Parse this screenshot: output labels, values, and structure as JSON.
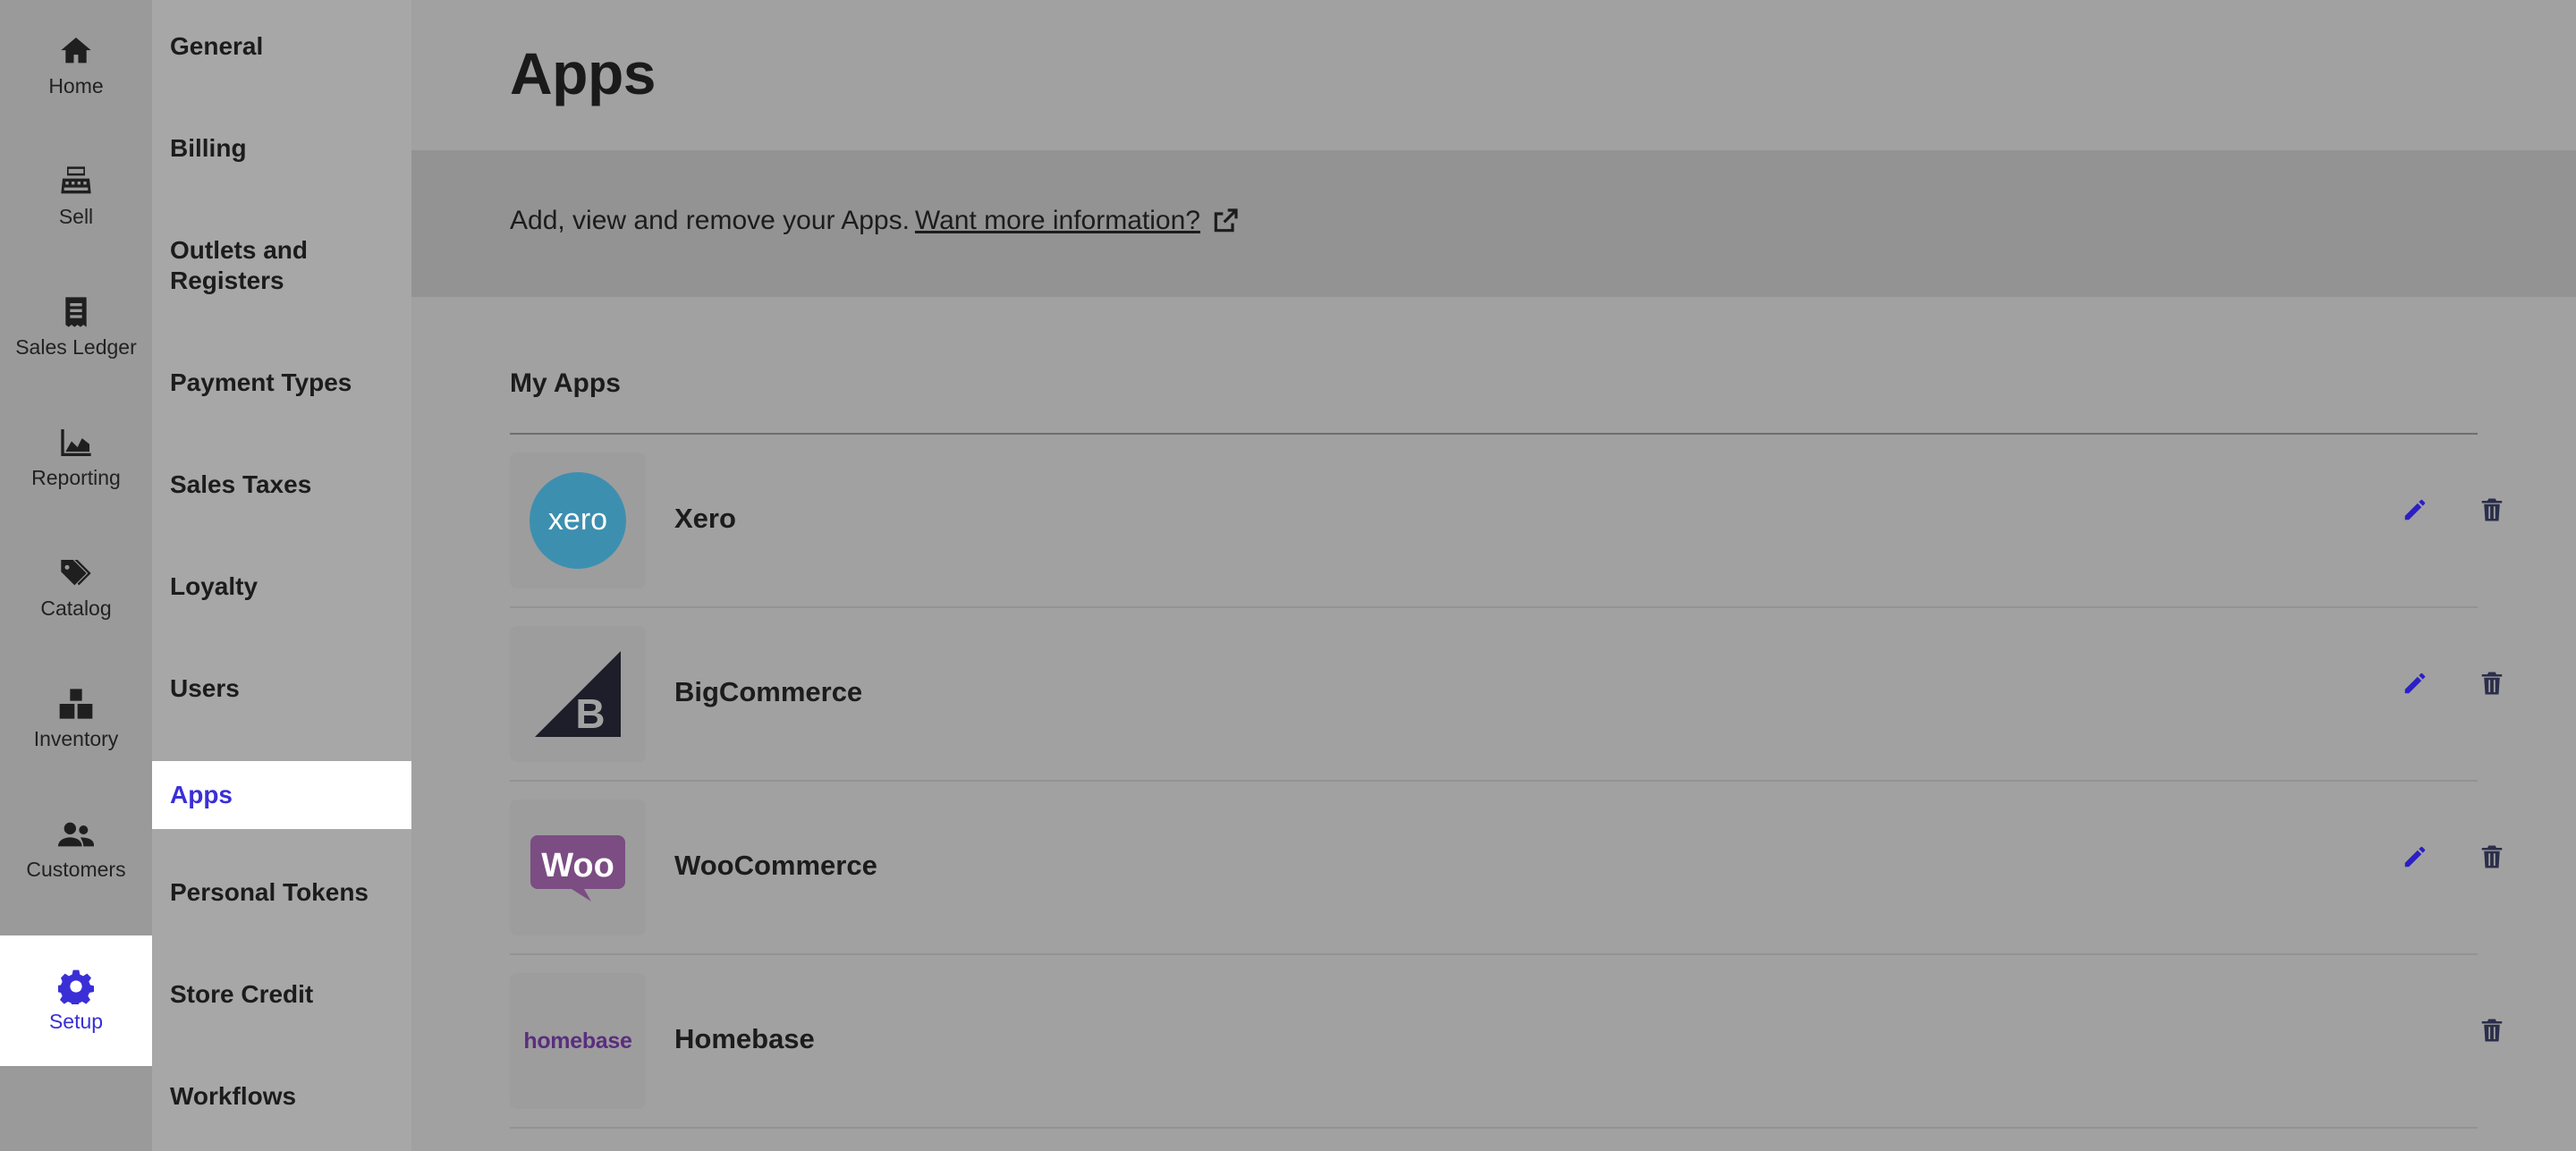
{
  "rail": {
    "items": [
      {
        "label": "Home",
        "icon": "home-icon"
      },
      {
        "label": "Sell",
        "icon": "register-icon"
      },
      {
        "label": "Sales Ledger",
        "icon": "receipt-icon"
      },
      {
        "label": "Reporting",
        "icon": "area-chart-icon"
      },
      {
        "label": "Catalog",
        "icon": "tags-icon"
      },
      {
        "label": "Inventory",
        "icon": "boxes-icon"
      },
      {
        "label": "Customers",
        "icon": "users-icon"
      },
      {
        "label": "Setup",
        "icon": "gear-icon",
        "active": true
      }
    ]
  },
  "submenu": {
    "items": [
      {
        "label": "General"
      },
      {
        "label": "Billing"
      },
      {
        "label": "Outlets and Registers"
      },
      {
        "label": "Payment Types"
      },
      {
        "label": "Sales Taxes"
      },
      {
        "label": "Loyalty"
      },
      {
        "label": "Users"
      },
      {
        "label": "Apps",
        "active": true
      },
      {
        "label": "Personal Tokens"
      },
      {
        "label": "Store Credit"
      },
      {
        "label": "Workflows"
      }
    ]
  },
  "main": {
    "title": "Apps",
    "info_text": "Add, view and remove your Apps.",
    "info_link": "Want more information?",
    "section_title": "My Apps",
    "apps": [
      {
        "name": "Xero",
        "logo_text": "xero",
        "editable": true
      },
      {
        "name": "BigCommerce",
        "logo_text": "B",
        "editable": true
      },
      {
        "name": "WooCommerce",
        "logo_text": "Woo",
        "editable": true
      },
      {
        "name": "Homebase",
        "logo_text": "homebase",
        "editable": false
      }
    ]
  },
  "colors": {
    "accent": "#3a2fd6",
    "edit_icon": "#2c1fc4",
    "delete_icon": "#2b2e4a",
    "xero": "#3d8fb0",
    "woo": "#7b4d83",
    "homebase": "#5a2e7e"
  }
}
